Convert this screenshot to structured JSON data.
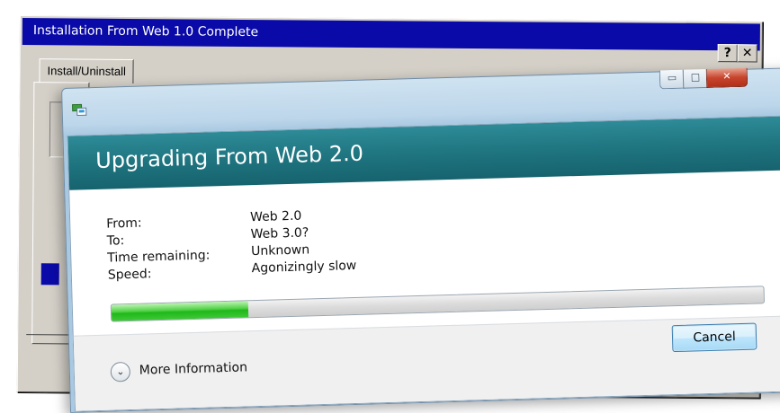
{
  "classic_window": {
    "title": "Installation From Web 1.0 Complete",
    "help_label": "?",
    "close_label": "✕",
    "tab_label": "Install/Uninstall"
  },
  "vista_window": {
    "minimize_label": "▭",
    "maximize_label": "□",
    "close_label": "✕",
    "heading": "Upgrading From Web 2.0",
    "details": [
      {
        "label": "From:",
        "value": "Web 2.0"
      },
      {
        "label": "To:",
        "value": "Web 3.0?"
      },
      {
        "label": "Time remaining:",
        "value": "Unknown"
      },
      {
        "label": "Speed:",
        "value": "Agonizingly slow"
      }
    ],
    "progress": 0.21,
    "more_info_label": "More Information",
    "more_info_icon": "⌄",
    "cancel_label": "Cancel"
  },
  "colors": {
    "classic_title_bg": "#0a0aa8",
    "vista_header_bg": "#1f7580",
    "progress_green": "#3ec836"
  }
}
